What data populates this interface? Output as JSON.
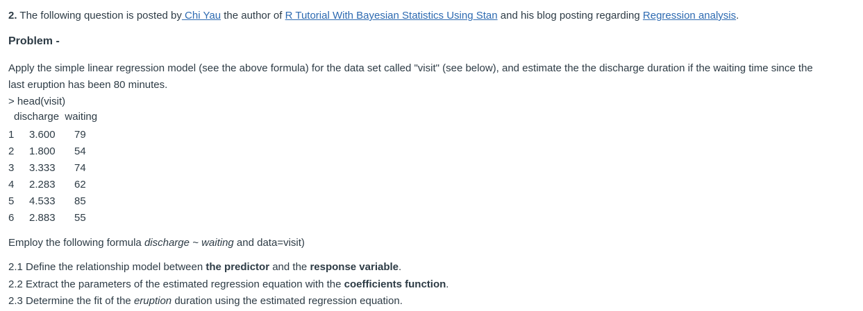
{
  "intro": {
    "number": "2.",
    "t1": " The following question is posted by",
    "author": " Chi Yau",
    "t2": " the author of ",
    "book": "R Tutorial With Bayesian Statistics Using Stan",
    "t3": " and his blog posting regarding ",
    "blog": "Regression analysis",
    "t4": "."
  },
  "problem_heading": "Problem -",
  "para1_line1": "Apply the simple linear regression model (see the above formula) for the data set called \"visit\" (see below), and estimate the the discharge duration if the waiting time since the",
  "para1_line2": "last eruption has been 80 minutes.",
  "code_line": "> head(visit)",
  "table": {
    "header_discharge": "discharge",
    "header_waiting": "waiting",
    "rows": [
      {
        "idx": "1",
        "discharge": "3.600",
        "waiting": "79"
      },
      {
        "idx": "2",
        "discharge": "1.800",
        "waiting": "54"
      },
      {
        "idx": "3",
        "discharge": "3.333",
        "waiting": "74"
      },
      {
        "idx": "4",
        "discharge": "2.283",
        "waiting": "62"
      },
      {
        "idx": "5",
        "discharge": "4.533",
        "waiting": "85"
      },
      {
        "idx": "6",
        "discharge": "2.883",
        "waiting": "55"
      }
    ]
  },
  "formula": {
    "t1": "Employ the following formula ",
    "formula_italic": "discharge ~ waiting",
    "t2": " and data=visit)"
  },
  "q21": {
    "t1": "2.1 Define the relationship model between ",
    "b1": "the predictor",
    "t2": " and the ",
    "b2": "response variable",
    "t3": "."
  },
  "q22": {
    "t1": "2.2 Extract the parameters of the estimated regression equation with the ",
    "b1": "coefficients function",
    "t2": "."
  },
  "q23": {
    "t1": "2.3 Determine the fit of the ",
    "i1": "eruption",
    "t2": " duration using the estimated regression equation."
  }
}
